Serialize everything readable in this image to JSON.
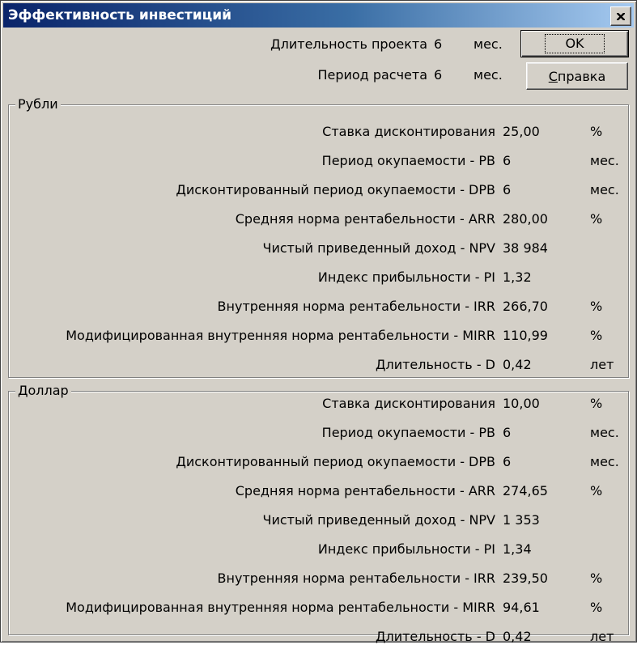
{
  "window": {
    "title": "Эффективность инвестиций"
  },
  "header": {
    "duration_label": "Длительность проекта",
    "duration_value": "6",
    "duration_unit": "мес.",
    "period_label": "Период расчета",
    "period_value": "6",
    "period_unit": "мес."
  },
  "buttons": {
    "ok_label": "OK",
    "help_prefix": "С",
    "help_rest": "правка"
  },
  "groups": [
    {
      "legend": "Рубли",
      "rows": [
        {
          "label": "Ставка дисконтирования",
          "value": "25,00",
          "unit": "%"
        },
        {
          "label": "Период окупаемости - PB",
          "value": "6",
          "unit": "мес."
        },
        {
          "label": "Дисконтированный период окупаемости - DPB",
          "value": "6",
          "unit": "мес."
        },
        {
          "label": "Средняя норма рентабельности - ARR",
          "value": "280,00",
          "unit": "%"
        },
        {
          "label": "Чистый приведенный доход - NPV",
          "value": "38 984",
          "unit": ""
        },
        {
          "label": "Индекс прибыльности - PI",
          "value": "1,32",
          "unit": ""
        },
        {
          "label": "Внутренняя норма рентабельности - IRR",
          "value": "266,70",
          "unit": "%"
        },
        {
          "label": "Модифицированная внутренняя норма рентабельности - MIRR",
          "value": "110,99",
          "unit": "%"
        },
        {
          "label": "Длительность - D",
          "value": "0,42",
          "unit": "лет"
        }
      ]
    },
    {
      "legend": "Доллар",
      "rows": [
        {
          "label": "Ставка дисконтирования",
          "value": "10,00",
          "unit": "%"
        },
        {
          "label": "Период окупаемости - PB",
          "value": "6",
          "unit": "мес."
        },
        {
          "label": "Дисконтированный период окупаемости - DPB",
          "value": "6",
          "unit": "мес."
        },
        {
          "label": "Средняя норма рентабельности - ARR",
          "value": "274,65",
          "unit": "%"
        },
        {
          "label": "Чистый приведенный доход - NPV",
          "value": "1 353",
          "unit": ""
        },
        {
          "label": "Индекс прибыльности - PI",
          "value": "1,34",
          "unit": ""
        },
        {
          "label": "Внутренняя норма рентабельности - IRR",
          "value": "239,50",
          "unit": "%"
        },
        {
          "label": "Модифицированная внутренняя норма рентабельности - MIRR",
          "value": "94,61",
          "unit": "%"
        },
        {
          "label": "Длительность - D",
          "value": "0,42",
          "unit": "лет"
        }
      ]
    }
  ]
}
